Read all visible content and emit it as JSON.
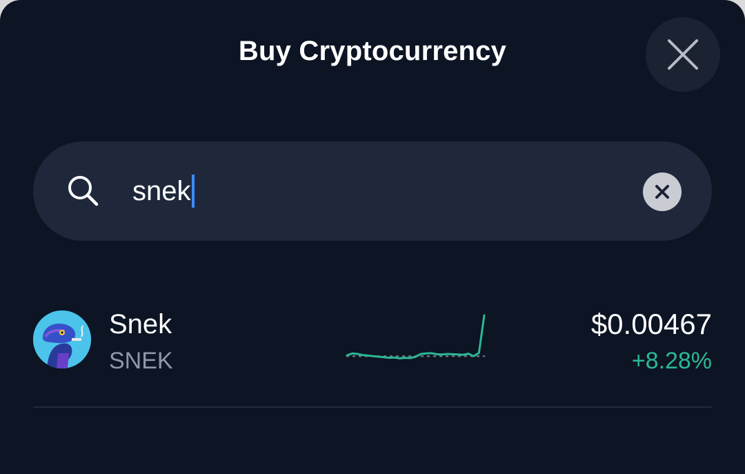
{
  "header": {
    "title": "Buy Cryptocurrency",
    "close_icon": "close-icon"
  },
  "search": {
    "icon": "search-icon",
    "value": "snek",
    "clear_icon": "clear-x-icon"
  },
  "results": [
    {
      "name": "Snek",
      "symbol": "SNEK",
      "price": "$0.00467",
      "change": "+8.28%",
      "change_color": "#2bb894",
      "avatar_icon": "snek-logo",
      "sparkline": {
        "type": "line",
        "values": [
          0.215,
          0.25,
          0.24,
          0.22,
          0.21,
          0.2,
          0.19,
          0.18,
          0.17,
          0.175,
          0.16,
          0.17,
          0.165,
          0.19,
          0.24,
          0.25,
          0.255,
          0.235,
          0.23,
          0.24,
          0.235,
          0.23,
          0.225,
          0.245,
          0.2,
          0.26,
          0.95
        ],
        "baseline": 0.2,
        "color": "#2bb894"
      }
    }
  ],
  "colors": {
    "background": "#0d1424",
    "search_background": "#1f283b",
    "accent_positive": "#2bb894",
    "caret": "#3b8cff"
  }
}
